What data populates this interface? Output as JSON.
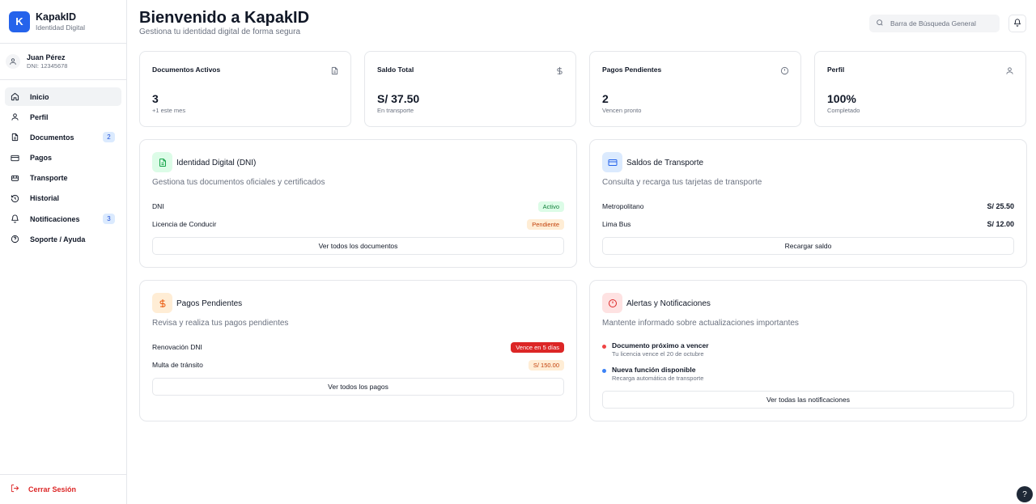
{
  "app": {
    "logo_letter": "K",
    "name": "KapakID",
    "subtitle": "Identidad Digital",
    "brand_color": "#2563eb"
  },
  "user": {
    "name": "Juan Pérez",
    "dni": "DNI: 12345678"
  },
  "sidebar": {
    "items": [
      {
        "label": "Inicio",
        "icon": "home-icon",
        "active": true
      },
      {
        "label": "Perfil",
        "icon": "user-icon"
      },
      {
        "label": "Documentos",
        "icon": "document-icon",
        "badge": "2"
      },
      {
        "label": "Pagos",
        "icon": "credit-card-icon"
      },
      {
        "label": "Transporte",
        "icon": "bus-icon"
      },
      {
        "label": "Historial",
        "icon": "history-icon"
      },
      {
        "label": "Notificaciones",
        "icon": "bell-icon",
        "badge": "3"
      },
      {
        "label": "Soporte / Ayuda",
        "icon": "help-circle-icon"
      }
    ],
    "logout_label": "Cerrar Sesión"
  },
  "header": {
    "title": "Bienvenido a KapakID",
    "subtitle": "Gestiona tu identidad digital de forma segura",
    "search_placeholder": "Barra de Búsqueda General"
  },
  "stats": [
    {
      "title": "Documentos Activos",
      "value": "3",
      "note": "+1 este mes",
      "icon": "document-icon"
    },
    {
      "title": "Saldo Total",
      "value": "S/ 37.50",
      "note": "En transporte",
      "icon": "dollar-icon"
    },
    {
      "title": "Pagos Pendientes",
      "value": "2",
      "note": "Vencen pronto",
      "icon": "clock-icon"
    },
    {
      "title": "Perfil",
      "value": "100%",
      "note": "Completado",
      "icon": "user-icon"
    }
  ],
  "identity": {
    "title": "Identidad Digital (DNI)",
    "description": "Gestiona tus documentos oficiales y certificados",
    "rows": [
      {
        "label": "DNI",
        "status": "Activo"
      },
      {
        "label": "Licencia de Conducir",
        "status": "Pendiente"
      }
    ],
    "button": "Ver todos los documentos"
  },
  "transport": {
    "title": "Saldos de Transporte",
    "description": "Consulta y recarga tus tarjetas de transporte",
    "rows": [
      {
        "label": "Metropolitano",
        "value": "S/ 25.50"
      },
      {
        "label": "Lima Bus",
        "value": "S/ 12.00"
      }
    ],
    "button": "Recargar saldo"
  },
  "payments": {
    "title": "Pagos Pendientes",
    "description": "Revisa y realiza tus pagos pendientes",
    "rows": [
      {
        "label": "Renovación DNI",
        "status": "Vence en 5 días"
      },
      {
        "label": "Multa de tránsito",
        "status": "S/ 150.00"
      }
    ],
    "button": "Ver todos los pagos"
  },
  "alerts": {
    "title": "Alertas y Notificaciones",
    "description": "Mantente informado sobre actualizaciones importantes",
    "items": [
      {
        "title": "Documento próximo a vencer",
        "subtitle": "Tu licencia vence el 20 de octubre",
        "color": "#ef4444"
      },
      {
        "title": "Nueva función disponible",
        "subtitle": "Recarga automática de transporte",
        "color": "#3b82f6"
      }
    ],
    "button": "Ver todas las notificaciones"
  },
  "help_fab": "?",
  "colors": {
    "active_bg": "#dcfce7",
    "active_text": "#15803d",
    "pending_bg": "#ffedd5",
    "pending_text": "#c2410c",
    "danger_bg": "#dc2626",
    "danger_text": "#ffffff",
    "logout": "#dc2626"
  }
}
